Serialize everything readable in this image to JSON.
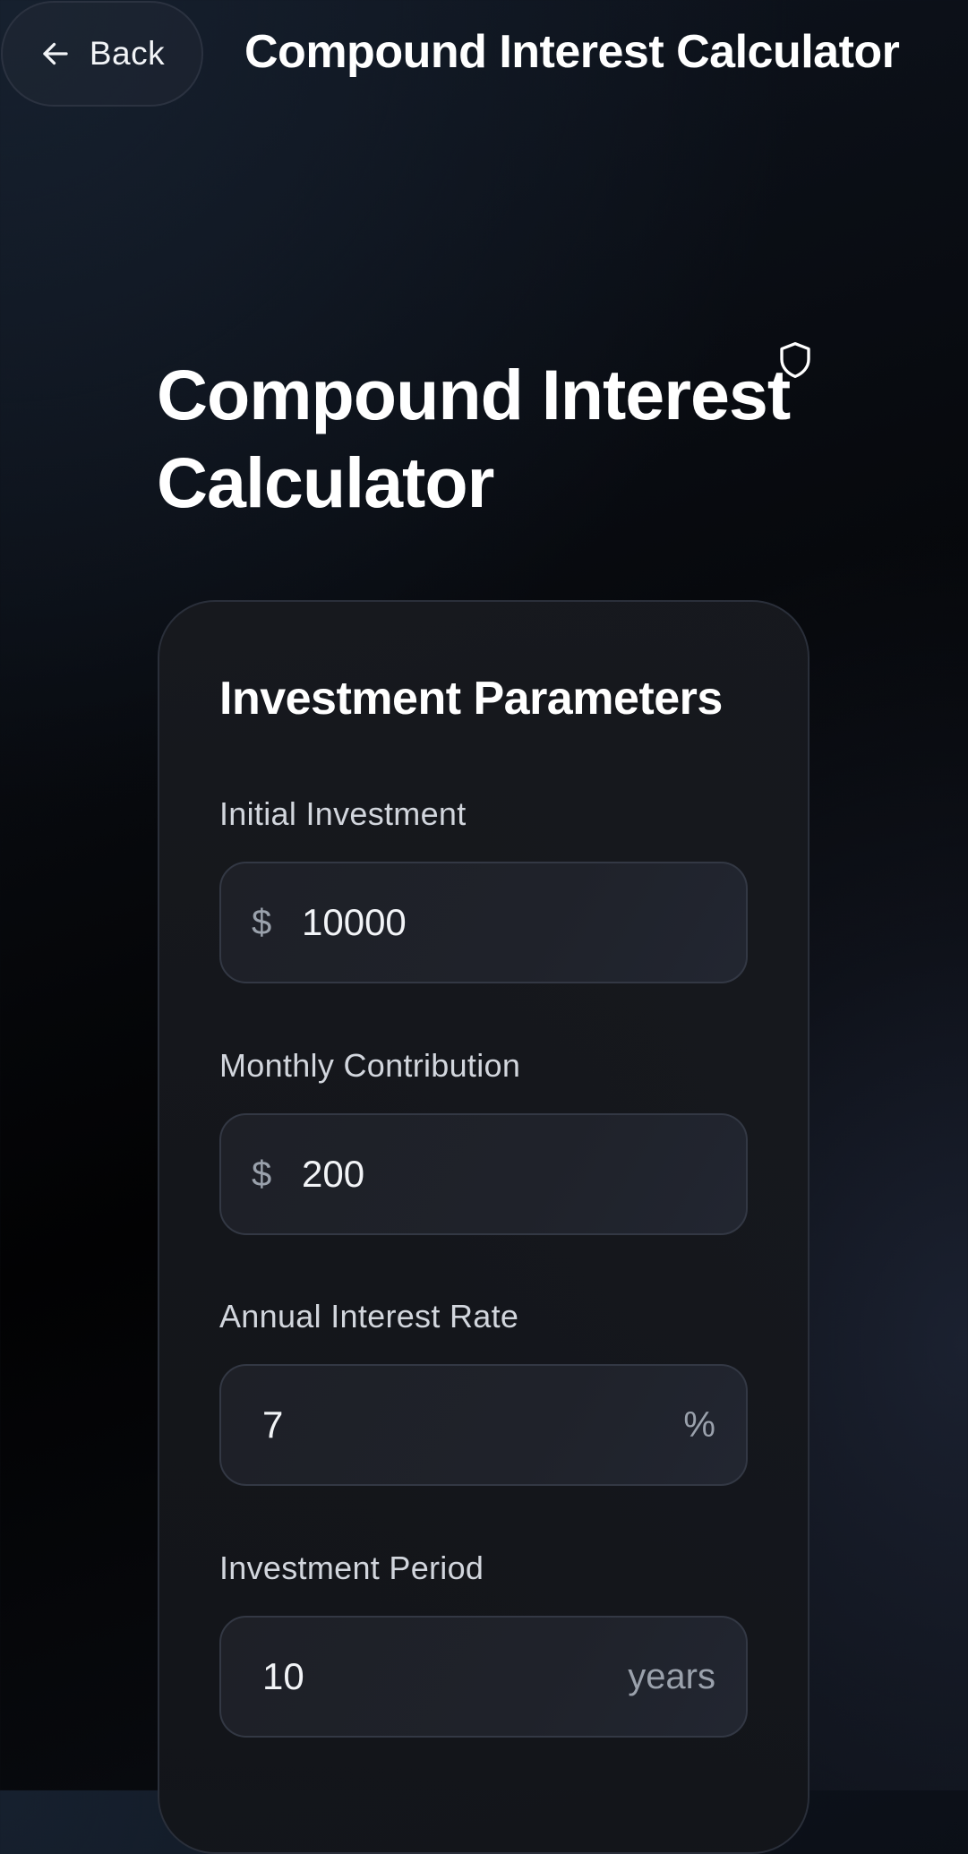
{
  "header": {
    "back_label": "Back",
    "title": "Compound Interest Calculator"
  },
  "page": {
    "title": "Compound Interest Calculator"
  },
  "parameters": {
    "heading": "Investment Parameters",
    "initial_investment": {
      "label": "Initial Investment",
      "prefix": "$",
      "value": "10000"
    },
    "monthly_contribution": {
      "label": "Monthly Contribution",
      "prefix": "$",
      "value": "200"
    },
    "annual_interest_rate": {
      "label": "Annual Interest Rate",
      "value": "7",
      "suffix": "%"
    },
    "investment_period": {
      "label": "Investment Period",
      "value": "10",
      "suffix": "years"
    }
  },
  "icons": {
    "back": "arrow-left-icon",
    "shield": "shield-icon"
  },
  "colors": {
    "background": "#07090d",
    "card": "#17191e",
    "field": "#1f222a",
    "text": "#ffffff",
    "muted": "#9aa1ac"
  }
}
